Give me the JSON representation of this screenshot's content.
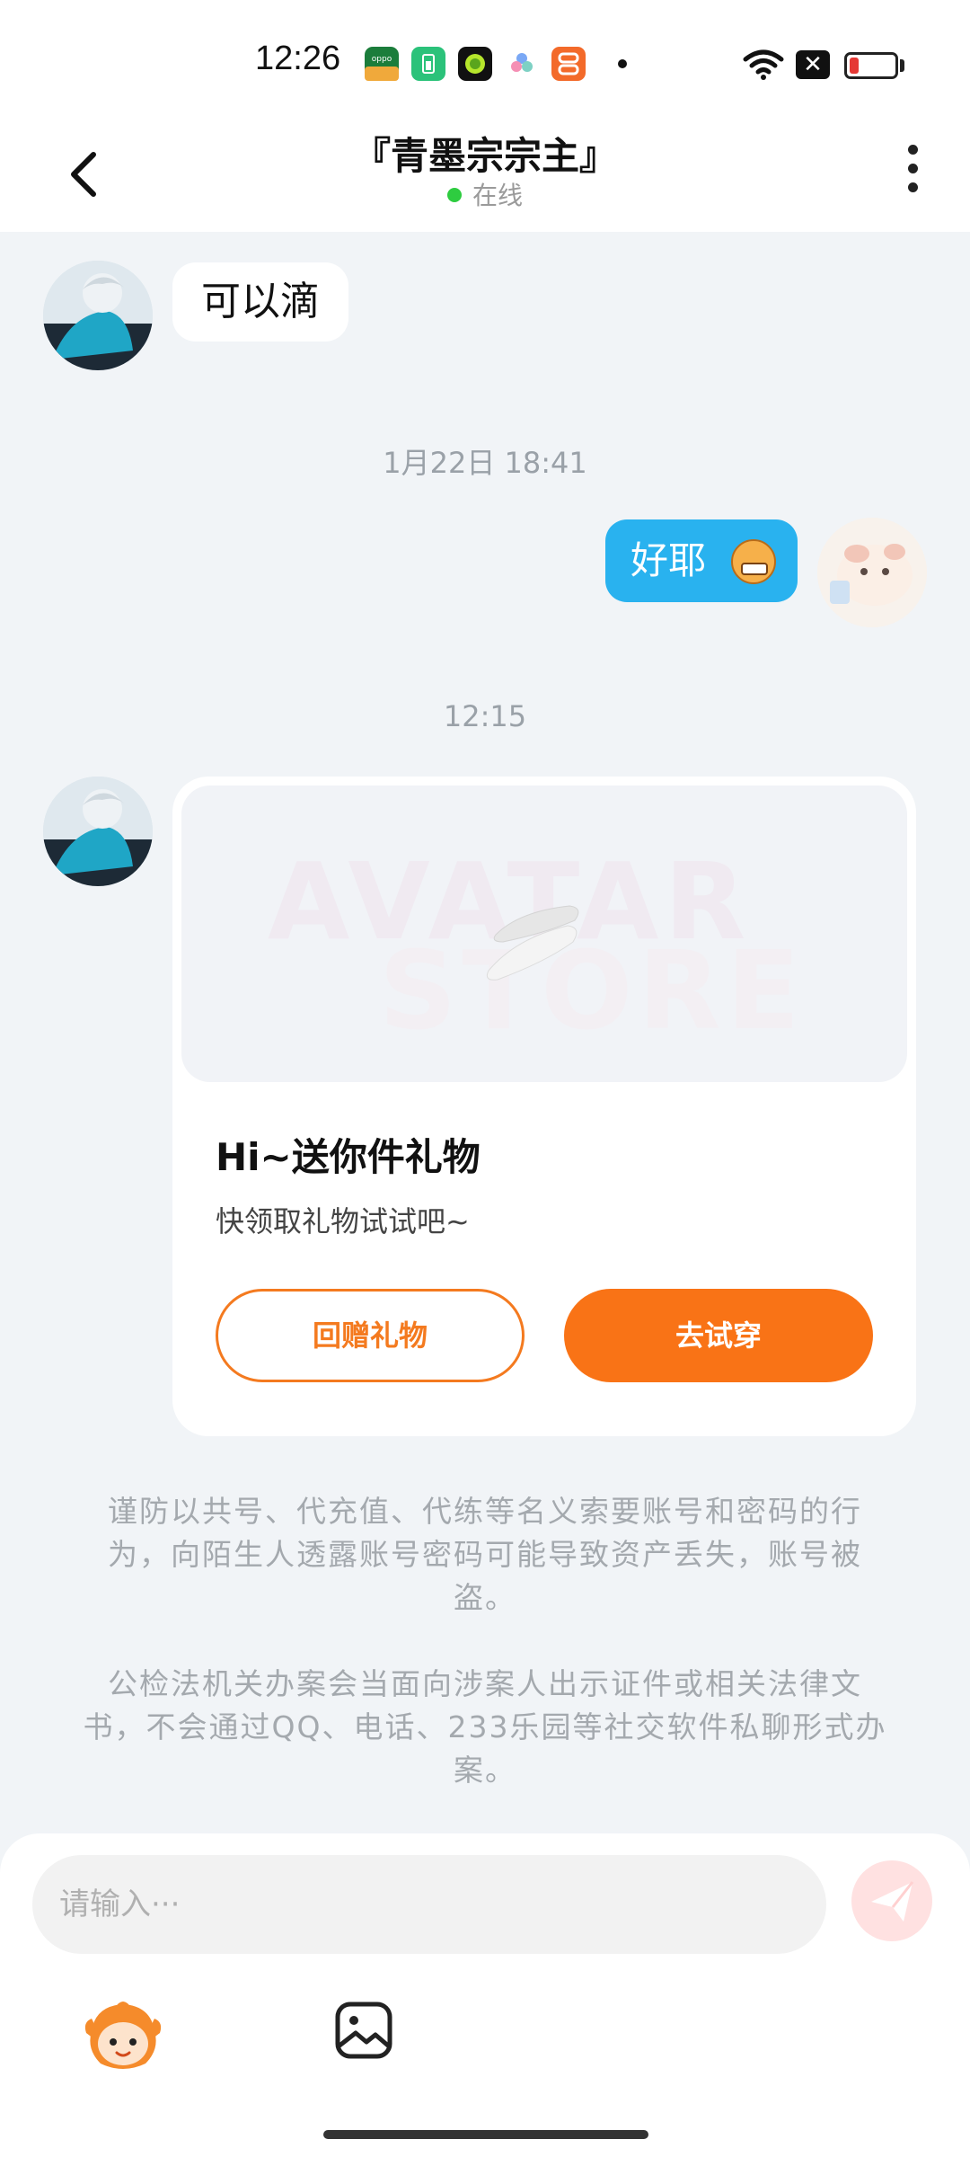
{
  "status_bar": {
    "time": "12:26",
    "apps": [
      {
        "icon": "oppo-app-icon",
        "color": "#1b7d3b"
      },
      {
        "icon": "battery-saver-app-icon",
        "color": "#2bc27a"
      },
      {
        "icon": "circle-app-icon",
        "color": "#111111"
      },
      {
        "icon": "petals-app-icon",
        "color": "#ffffff"
      },
      {
        "icon": "orange-app-icon",
        "color": "#f36a2a"
      }
    ],
    "x_badge": "✕"
  },
  "header": {
    "title": "『青墨宗宗主』",
    "status": "在线",
    "online_color": "#2ecc40"
  },
  "messages": {
    "m1_text": "可以滴",
    "time1": "1月22日 18:41",
    "m2_text": "好耶",
    "time2": "12:15"
  },
  "gift_card": {
    "watermark_line1": "AVATAR",
    "watermark_line2": "STORE",
    "title": "Hi~送你件礼物",
    "subtitle": "快领取礼物试试吧~",
    "return_gift_label": "回赠礼物",
    "try_on_label": "去试穿",
    "accent_color": "#f97316"
  },
  "notices": {
    "n1": "谨防以共号、代充值、代练等名义索要账号和密码的行为，向陌生人透露账号密码可能导致资产丢失，账号被盗。",
    "n2": "公检法机关办案会当面向涉案人出示证件或相关法律文书，不会通过QQ、电话、233乐园等社交软件私聊形式办案。"
  },
  "input": {
    "placeholder": "请输入···",
    "value": ""
  }
}
